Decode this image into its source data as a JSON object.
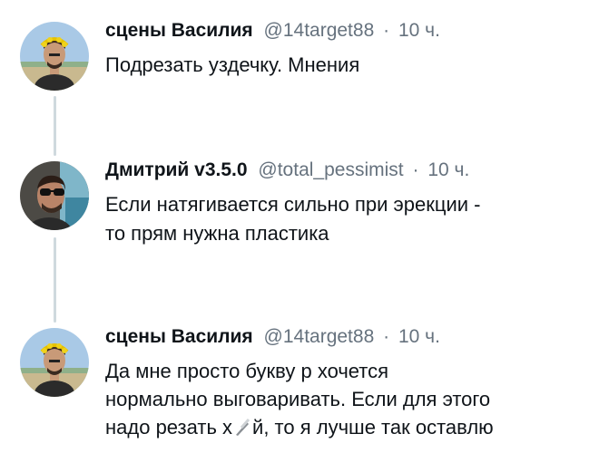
{
  "thread": {
    "tweets": [
      {
        "author_name": "сцены Василия",
        "handle": "@14target88",
        "separator": "·",
        "time": "10 ч.",
        "avatar_icon": "avatar-laurel-man",
        "text_lines": [
          "Подрезать уздечку. Мнения"
        ]
      },
      {
        "author_name": "Дмитрий v3.5.0",
        "handle": "@total_pessimist",
        "separator": "·",
        "time": "10 ч.",
        "avatar_icon": "avatar-sunglasses-man",
        "text_lines": [
          "Если натягивается сильно при эрекции -",
          "то прям нужна пластика"
        ]
      },
      {
        "author_name": "сцены Василия",
        "handle": "@14target88",
        "separator": "·",
        "time": "10 ч.",
        "avatar_icon": "avatar-laurel-man",
        "text_lines": [
          "Да мне просто букву р хочется",
          "нормально выговаривать. Если для этого"
        ],
        "last_line_before": "надо резать х",
        "last_line_after": "й, то я лучше так оставлю"
      }
    ]
  },
  "colors": {
    "text": "#0f1419",
    "meta": "#66727e",
    "thread_line": "#cfd9de"
  }
}
